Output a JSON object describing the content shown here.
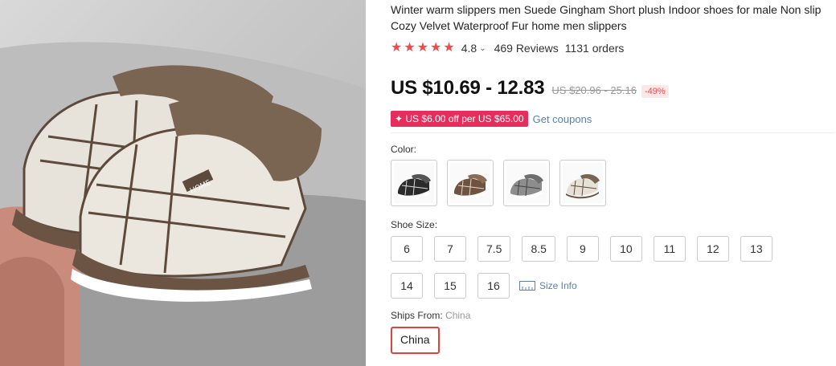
{
  "product": {
    "title": "Winter warm slippers men Suede Gingham Short plush Indoor shoes for male Non slip Cozy Velvet Waterproof Fur home men slippers",
    "image_label": "HOME"
  },
  "rating": {
    "stars": 5,
    "value": "4.8",
    "reviews": "469 Reviews",
    "orders": "1131 orders"
  },
  "pricing": {
    "price": "US $10.69 - 12.83",
    "original": "US $20.96 - 25.16",
    "discount": "-49%"
  },
  "coupon": {
    "badge": "✦ US $6.00 off per US $65.00",
    "link": "Get coupons"
  },
  "color": {
    "label": "Color:",
    "options": [
      "black",
      "coffee",
      "gray",
      "beige"
    ]
  },
  "size": {
    "label": "Shoe Size:",
    "options": [
      "6",
      "7",
      "7.5",
      "8.5",
      "9",
      "10",
      "11",
      "12",
      "13",
      "14",
      "15",
      "16"
    ],
    "size_info": "Size Info"
  },
  "shipping": {
    "label": "Ships From:",
    "value": "China",
    "selected": "China"
  },
  "colors_hex": {
    "accent": "#f04b4b",
    "coupon": "#e62e5c",
    "link": "#5c7fa6"
  }
}
